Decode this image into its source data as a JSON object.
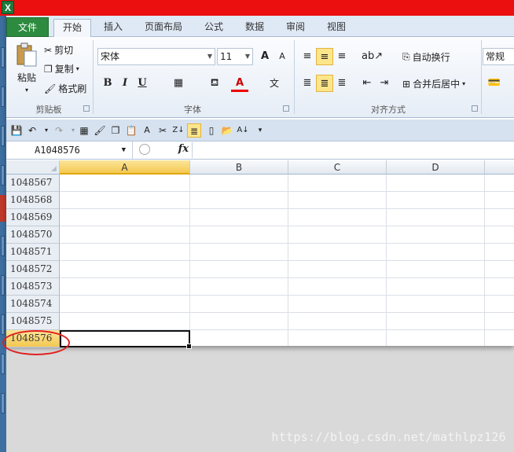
{
  "app": {
    "icon_letter": "X"
  },
  "tabs": [
    {
      "label": "文件"
    },
    {
      "label": "开始"
    },
    {
      "label": "插入"
    },
    {
      "label": "页面布局"
    },
    {
      "label": "公式"
    },
    {
      "label": "数据"
    },
    {
      "label": "审阅"
    },
    {
      "label": "视图"
    }
  ],
  "clipboard": {
    "paste_label": "粘贴",
    "cut_label": "剪切",
    "copy_label": "复制",
    "format_painter_label": "格式刷",
    "group_label": "剪贴板"
  },
  "font": {
    "font_name": "宋体",
    "font_size": "11",
    "grow_label": "A",
    "shrink_label": "A",
    "bold": "B",
    "italic": "I",
    "underline": "U",
    "font_color_label": "A",
    "phonetic_label": "文",
    "group_label": "字体"
  },
  "alignment": {
    "wrap_label": "自动换行",
    "merge_label": "合并后居中",
    "group_label": "对齐方式"
  },
  "number": {
    "format": "常规"
  },
  "namebox": {
    "value": "A1048576"
  },
  "formula": {
    "fx": "fx",
    "value": ""
  },
  "columns": [
    "A",
    "B",
    "C",
    "D"
  ],
  "rows": [
    "1048567",
    "1048568",
    "1048569",
    "1048570",
    "1048571",
    "1048572",
    "1048573",
    "1048574",
    "1048575",
    "1048576"
  ],
  "selected_cell": "A1048576",
  "watermark": "https://blog.csdn.net/mathlpz126",
  "colors": {
    "accent_red": "#ec0f0f",
    "file_tab": "#2d8b3f",
    "highlight": "#fde68a",
    "annotation": "#e02020"
  }
}
